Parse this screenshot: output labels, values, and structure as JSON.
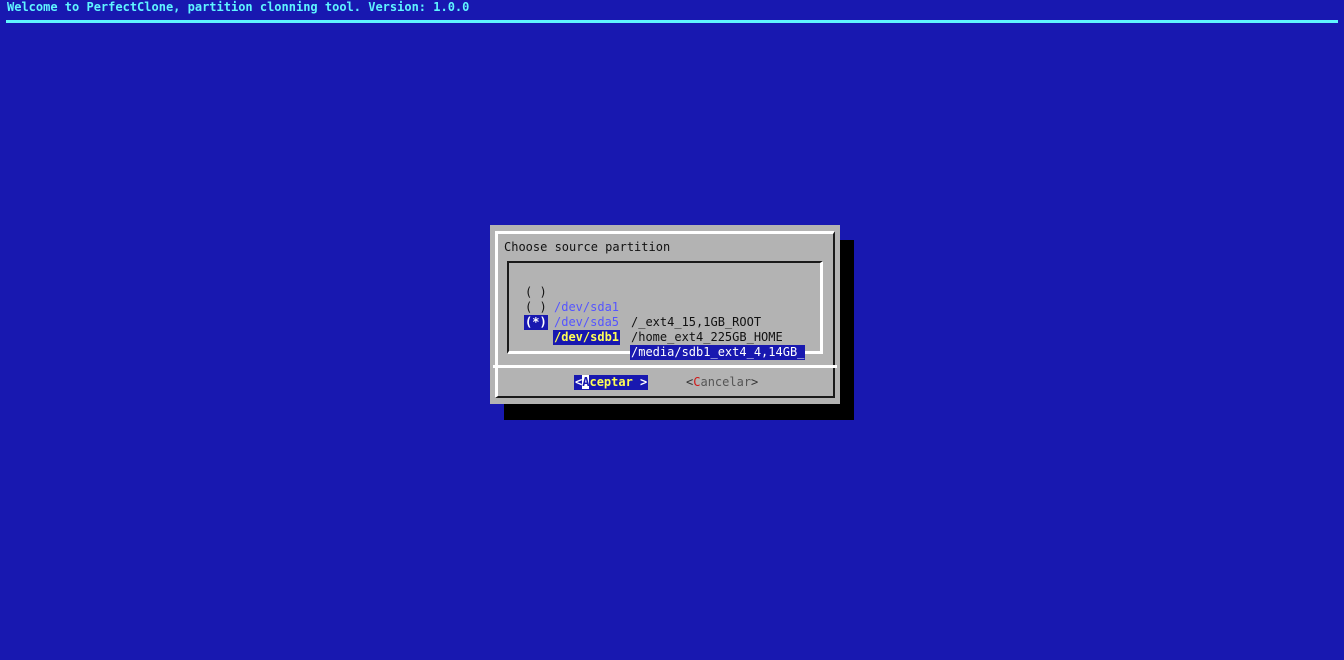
{
  "backtitle": "Welcome to PerfectClone, partition clonning tool. Version: 1.0.0",
  "dialog": {
    "title": "Choose source partition",
    "items": [
      {
        "radio": "( )",
        "device": "/dev/sda1",
        "description": "/_ext4_15,1GB_ROOT",
        "selected": false
      },
      {
        "radio": "( )",
        "device": "/dev/sda5",
        "description": "/home_ext4_225GB_HOME",
        "selected": false
      },
      {
        "radio": "(*)",
        "device": "/dev/sdb1",
        "description": "/media/sdb1_ext4_4,14GB_",
        "selected": true
      }
    ],
    "buttons": {
      "ok": {
        "open": "<",
        "hotkey": "A",
        "rest": "ceptar",
        "close": " >"
      },
      "cancel": {
        "open": "<",
        "hotkey": "C",
        "rest": "ancelar",
        "close": ">"
      }
    }
  },
  "colors": {
    "background": "#1818b0",
    "backtitle": "#5ff5ff",
    "dialog": "#b3b3b3",
    "device": "#5555ff",
    "highlight_text": "#ffff55",
    "hotkey_cancel": "#d01818"
  }
}
